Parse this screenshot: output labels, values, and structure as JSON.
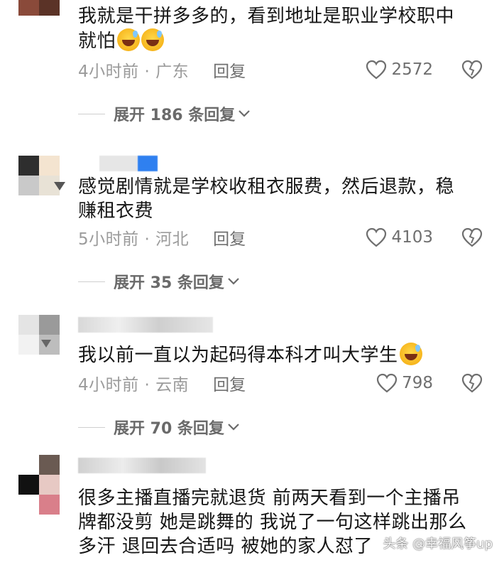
{
  "comments": [
    {
      "text_line1": "我就是干拼多多的，看到地址是职业学校职中",
      "text_line2": "就怕",
      "time_location": "4小时前 · 广东",
      "reply_label": "回复",
      "likes": "2572",
      "expand_label": "展开 186 条回复"
    },
    {
      "text_line1": "感觉剧情就是学校收租衣服费，然后退款，稳",
      "text_line2": "赚租衣费",
      "time_location": "5小时前 · 河北",
      "reply_label": "回复",
      "likes": "4103",
      "expand_label": "展开 35 条回复"
    },
    {
      "text_line1": "我以前一直以为起码得本科才叫大学生",
      "time_location": "4小时前 · 云南",
      "reply_label": "回复",
      "likes": "798",
      "expand_label": "展开 70 条回复"
    },
    {
      "text_line1": "很多主播直播完就退货 前两天看到一个主播吊",
      "text_line2": "牌都没剪 她是跳舞的 我说了一句这样跳出那么",
      "text_line3": "多汗 退回去合适吗 被她的家人怼了"
    }
  ],
  "watermark": "头条 @幸福风筝up",
  "colors": {
    "text": "#161616",
    "meta": "#9b9b9b",
    "action": "#6f6f6f"
  },
  "icons": [
    "heart-icon",
    "dislike-icon",
    "chevron-down-icon",
    "emoji-icon"
  ]
}
